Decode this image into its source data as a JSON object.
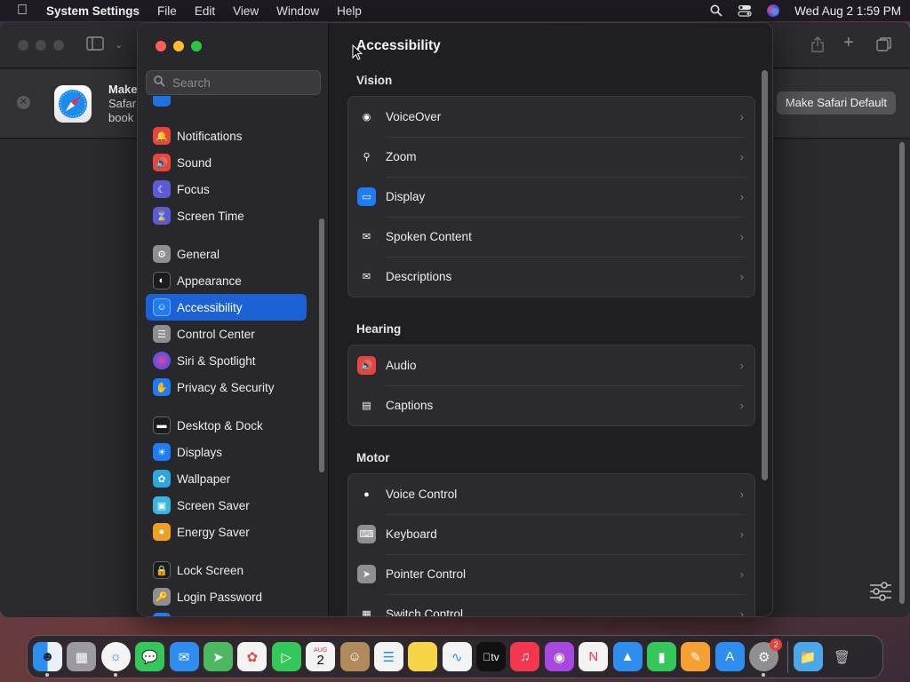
{
  "menubar": {
    "app_name": "System Settings",
    "menus": [
      "File",
      "Edit",
      "View",
      "Window",
      "Help"
    ],
    "datetime": "Wed Aug 2  1:59 PM",
    "icons": [
      "apple-icon",
      "spotlight-icon",
      "control-center-icon",
      "siri-icon"
    ]
  },
  "safari_window": {
    "banner_title": "Make",
    "banner_line2": "Safar",
    "banner_line3": "book",
    "default_button": "Make Safari Default"
  },
  "search": {
    "placeholder": "Search"
  },
  "sidebar": {
    "items": [
      {
        "label": "Notifications",
        "icon": "bell-icon",
        "color": "#e8453c"
      },
      {
        "label": "Sound",
        "icon": "speaker-icon",
        "color": "#e8453c"
      },
      {
        "label": "Focus",
        "icon": "moon-icon",
        "color": "#5b5bd6"
      },
      {
        "label": "Screen Time",
        "icon": "hourglass-icon",
        "color": "#5b5bd6"
      },
      {
        "label": "General",
        "icon": "gear-icon",
        "color": "#8e8e93"
      },
      {
        "label": "Appearance",
        "icon": "appearance-icon",
        "color": "#1c1c1e"
      },
      {
        "label": "Accessibility",
        "icon": "accessibility-icon",
        "color": "#1e7cf5"
      },
      {
        "label": "Control Center",
        "icon": "switches-icon",
        "color": "#8e8e93"
      },
      {
        "label": "Siri & Spotlight",
        "icon": "siri-icon",
        "color": "#b04de0"
      },
      {
        "label": "Privacy & Security",
        "icon": "hand-icon",
        "color": "#1e7cf5"
      },
      {
        "label": "Desktop & Dock",
        "icon": "dock-icon",
        "color": "#1c1c1e"
      },
      {
        "label": "Displays",
        "icon": "sun-icon",
        "color": "#1e7cf5"
      },
      {
        "label": "Wallpaper",
        "icon": "flower-icon",
        "color": "#2aa8e0"
      },
      {
        "label": "Screen Saver",
        "icon": "screensaver-icon",
        "color": "#38b6e0"
      },
      {
        "label": "Energy Saver",
        "icon": "bulb-icon",
        "color": "#f0a020"
      },
      {
        "label": "Lock Screen",
        "icon": "lock-icon",
        "color": "#1c1c1e"
      },
      {
        "label": "Login Password",
        "icon": "person-lock-icon",
        "color": "#8e8e93"
      }
    ],
    "selected": "Accessibility"
  },
  "main": {
    "title": "Accessibility",
    "sections": [
      {
        "title": "Vision",
        "rows": [
          {
            "label": "VoiceOver",
            "icon": "voiceover-icon",
            "color": "#2c2c2e"
          },
          {
            "label": "Zoom",
            "icon": "zoom-icon",
            "color": "#2c2c2e"
          },
          {
            "label": "Display",
            "icon": "display-icon",
            "color": "#1e7cf5"
          },
          {
            "label": "Spoken Content",
            "icon": "speech-bubble-icon",
            "color": "#2c2c2e"
          },
          {
            "label": "Descriptions",
            "icon": "speech-bubble-icon",
            "color": "#2c2c2e"
          }
        ]
      },
      {
        "title": "Hearing",
        "rows": [
          {
            "label": "Audio",
            "icon": "speaker-icon",
            "color": "#e8453c"
          },
          {
            "label": "Captions",
            "icon": "captions-icon",
            "color": "#2c2c2e"
          }
        ]
      },
      {
        "title": "Motor",
        "rows": [
          {
            "label": "Voice Control",
            "icon": "voice-control-icon",
            "color": "#2c2c2e"
          },
          {
            "label": "Keyboard",
            "icon": "keyboard-icon",
            "color": "#8e8e93"
          },
          {
            "label": "Pointer Control",
            "icon": "pointer-icon",
            "color": "#8e8e93"
          },
          {
            "label": "Switch Control",
            "icon": "grid-icon",
            "color": "#2c2c2e"
          }
        ]
      }
    ]
  },
  "dock": {
    "apps": [
      {
        "name": "Finder",
        "icon": "finder-icon",
        "color": "#2d8ef0",
        "running": true
      },
      {
        "name": "Launchpad",
        "icon": "launchpad-icon",
        "color": "#9a9aa0",
        "running": false
      },
      {
        "name": "Safari",
        "icon": "safari-icon",
        "color": "#2d8ef0",
        "running": true
      },
      {
        "name": "Messages",
        "icon": "messages-icon",
        "color": "#34c759",
        "running": false
      },
      {
        "name": "Mail",
        "icon": "mail-icon",
        "color": "#2d8ef0",
        "running": false
      },
      {
        "name": "Maps",
        "icon": "maps-icon",
        "color": "#4cb860",
        "running": false
      },
      {
        "name": "Photos",
        "icon": "photos-icon",
        "color": "#f3f3f3",
        "running": false
      },
      {
        "name": "FaceTime",
        "icon": "facetime-icon",
        "color": "#34c759",
        "running": false
      },
      {
        "name": "Calendar",
        "icon": "calendar-icon",
        "color": "#f3f3f3",
        "running": false
      },
      {
        "name": "Contacts",
        "icon": "contacts-icon",
        "color": "#b08a5a",
        "running": false
      },
      {
        "name": "Reminders",
        "icon": "reminders-icon",
        "color": "#f3f3f3",
        "running": false
      },
      {
        "name": "Notes",
        "icon": "notes-icon",
        "color": "#f8d548",
        "running": false
      },
      {
        "name": "Freeform",
        "icon": "freeform-icon",
        "color": "#f3f3f3",
        "running": false
      },
      {
        "name": "TV",
        "icon": "tv-icon",
        "color": "#111111",
        "running": false
      },
      {
        "name": "Music",
        "icon": "music-icon",
        "color": "#f5364f",
        "running": false
      },
      {
        "name": "Podcasts",
        "icon": "podcasts-icon",
        "color": "#a848e0",
        "running": false
      },
      {
        "name": "News",
        "icon": "news-icon",
        "color": "#f3f3f3",
        "running": false
      },
      {
        "name": "Keynote",
        "icon": "keynote-icon",
        "color": "#2d8ef0",
        "running": false
      },
      {
        "name": "Numbers",
        "icon": "numbers-icon",
        "color": "#34c759",
        "running": false
      },
      {
        "name": "Pages",
        "icon": "pages-icon",
        "color": "#f5a030",
        "running": false
      },
      {
        "name": "App Store",
        "icon": "appstore-icon",
        "color": "#2d8ef0",
        "running": false
      },
      {
        "name": "System Settings",
        "icon": "settings-icon",
        "color": "#8e8e93",
        "running": true,
        "badge": "2"
      }
    ],
    "extras": [
      {
        "name": "Downloads",
        "icon": "folder-icon",
        "color": "#4aa8e8"
      },
      {
        "name": "Trash",
        "icon": "trash-icon",
        "color": "#8e8e93"
      }
    ],
    "calendar_month": "AUG",
    "calendar_day": "2",
    "tv_label": "tv"
  }
}
